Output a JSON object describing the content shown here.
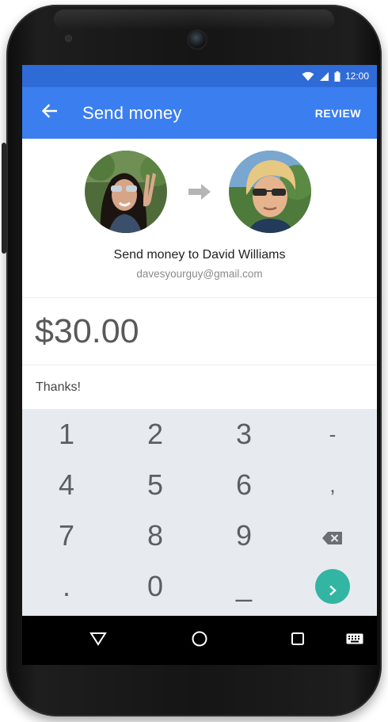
{
  "status_bar": {
    "time": "12:00"
  },
  "app_bar": {
    "title": "Send money",
    "review_label": "REVIEW",
    "back_icon": "arrow-left-icon"
  },
  "recipient": {
    "heading": "Send money to David Williams",
    "email": "davesyourguy@gmail.com",
    "transfer_icon": "arrow-right-icon"
  },
  "amount": "$30.00",
  "memo": "Thanks!",
  "keypad": {
    "keys": [
      "1",
      "2",
      "3",
      "-",
      "4",
      "5",
      "6",
      ",",
      "7",
      "8",
      "9",
      ".",
      "0",
      "_"
    ],
    "backspace_icon": "backspace-icon",
    "next_icon": "chevron-right-icon"
  },
  "nav_bar": {
    "back_icon": "triangle-back-icon",
    "home_icon": "circle-home-icon",
    "recents_icon": "square-recents-icon",
    "keyboard_icon": "keyboard-icon"
  },
  "colors": {
    "status_bar": "#2f6bd7",
    "app_bar": "#3b7ef0",
    "keypad_bg": "#e7eaee",
    "next_button": "#32b5a3"
  }
}
